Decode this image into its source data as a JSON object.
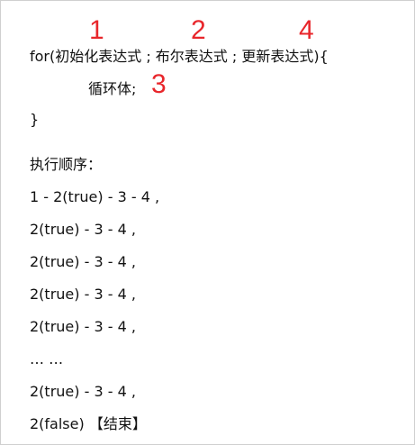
{
  "code": {
    "for_line": "for(初始化表达式 ; 布尔表达式 ; 更新表达式){",
    "body_line": "循环体;",
    "closing_brace": "}"
  },
  "annotations": {
    "n1": "1",
    "n2": "2",
    "n3": "3",
    "n4": "4",
    "color": "#e8262b"
  },
  "order": {
    "title": "执行顺序：",
    "steps": [
      "1 - 2(true) - 3 - 4 ,",
      "2(true) - 3 - 4 ,",
      "2(true) - 3 - 4 ,",
      "2(true) - 3 - 4 ,",
      "2(true) - 3 - 4 ,",
      "… …",
      "2(true) - 3 - 4 ,",
      "2(false) 【结束】"
    ]
  }
}
